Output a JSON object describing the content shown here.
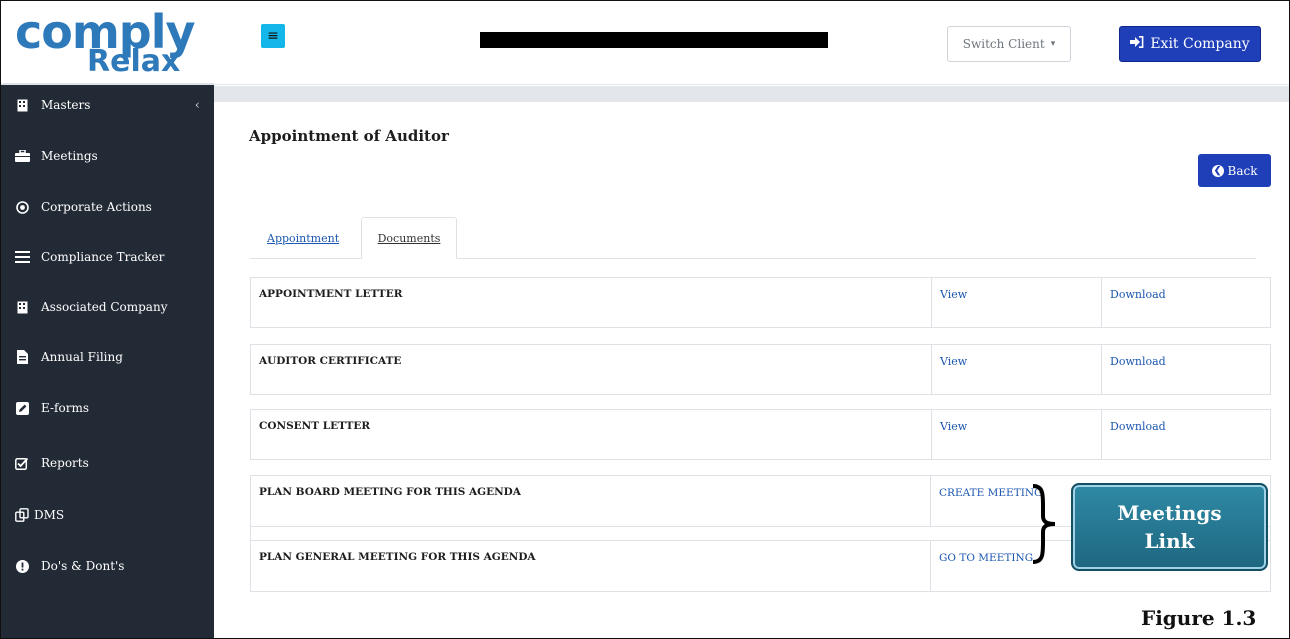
{
  "app": {
    "logo_main": "comply",
    "logo_sub": "Relax"
  },
  "sidebar": {
    "items": [
      {
        "label": "Masters",
        "icon": "building-icon",
        "has_chevron": true
      },
      {
        "label": "Meetings",
        "icon": "briefcase-icon"
      },
      {
        "label": "Corporate Actions",
        "icon": "target-circle-icon"
      },
      {
        "label": "Compliance Tracker",
        "icon": "list-icon"
      },
      {
        "label": "Associated Company",
        "icon": "building-icon"
      },
      {
        "label": "Annual Filing",
        "icon": "file-text-icon"
      },
      {
        "label": "E-forms",
        "icon": "edit-square-icon"
      },
      {
        "label": "Reports",
        "icon": "checkbox-icon"
      },
      {
        "label": "DMS",
        "icon": "copy-icon"
      },
      {
        "label": "Do's & Dont's",
        "icon": "exclamation-circle-icon"
      }
    ],
    "chevron": "‹"
  },
  "topbar": {
    "menu_icon": "≡",
    "switch_client": "Switch Client",
    "switch_caret": "▾",
    "exit_label": "Exit Company"
  },
  "page": {
    "title": "Appointment of Auditor",
    "back_label": "Back"
  },
  "tabs": [
    {
      "label": "Appointment",
      "active": false
    },
    {
      "label": "Documents",
      "active": true
    }
  ],
  "documents": [
    {
      "name": "APPOINTMENT LETTER",
      "view": "View",
      "download": "Download"
    },
    {
      "name": "AUDITOR CERTIFICATE",
      "view": "View",
      "download": "Download"
    },
    {
      "name": "CONSENT LETTER",
      "view": "View",
      "download": "Download"
    }
  ],
  "meetings": [
    {
      "name": "PLAN BOARD MEETING FOR THIS AGENDA",
      "link": "CREATE MEETING"
    },
    {
      "name": "PLAN GENERAL MEETING FOR THIS AGENDA",
      "link": "GO TO MEETING"
    }
  ],
  "annotation": {
    "callout_line1": "Meetings",
    "callout_line2": "Link",
    "figure": "Figure 1.3"
  },
  "colors": {
    "sidebar_bg": "#222a35",
    "primary_button": "#1f3fb8",
    "menu_button": "#14b7e9",
    "link": "#1b56b0",
    "callout": "#2f8aa5"
  }
}
